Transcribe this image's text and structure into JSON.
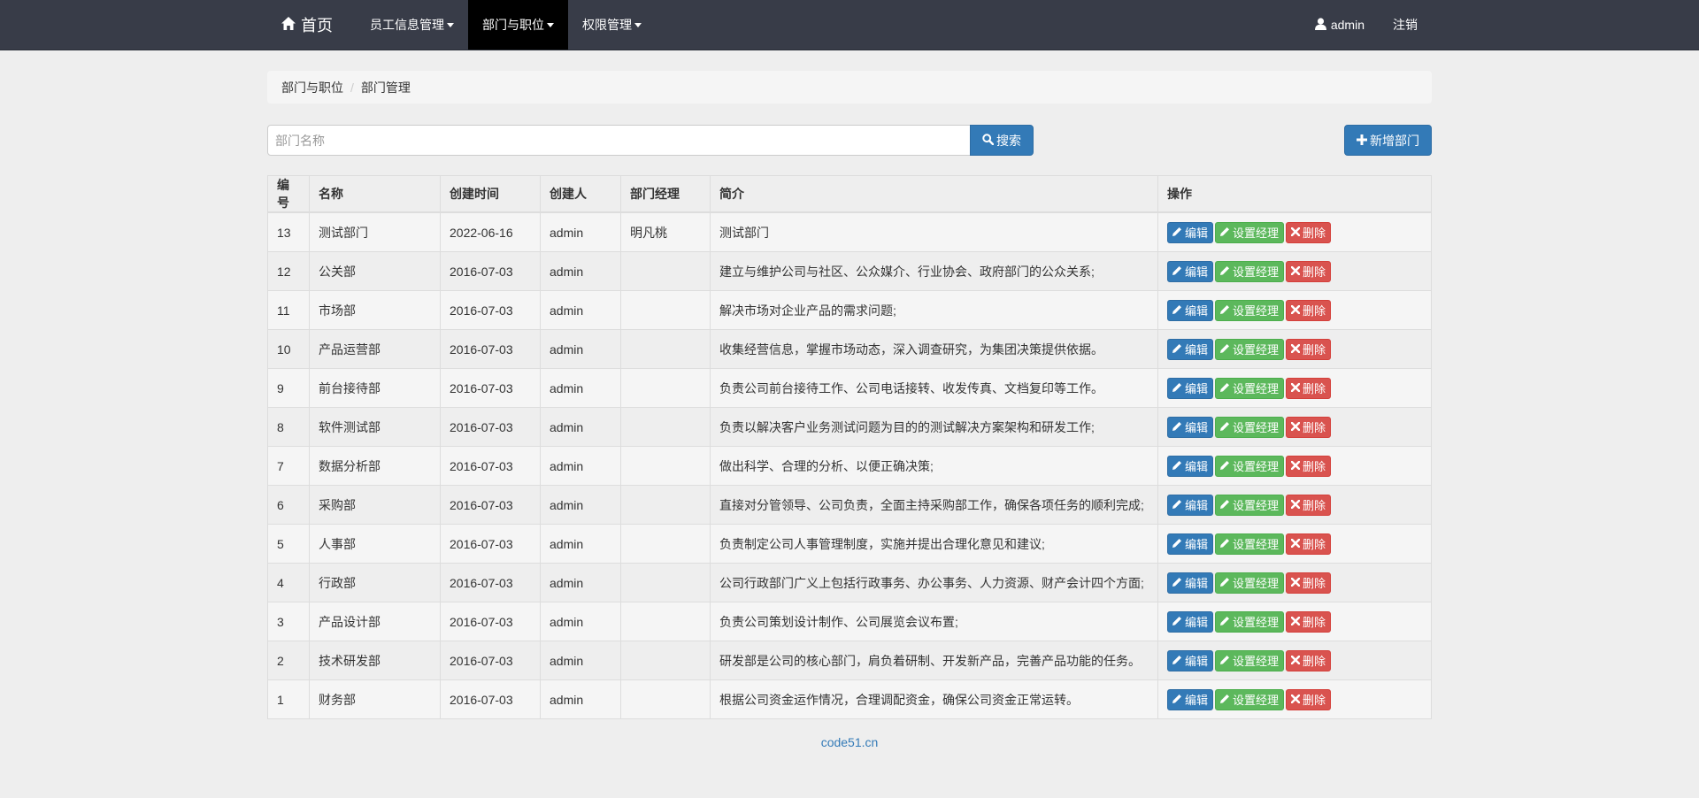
{
  "nav": {
    "brand": "首页",
    "menus": [
      {
        "label": "员工信息管理",
        "active": false
      },
      {
        "label": "部门与职位",
        "active": true
      },
      {
        "label": "权限管理",
        "active": false
      }
    ],
    "user": "admin",
    "logout": "注销"
  },
  "breadcrumb": {
    "parent": "部门与职位",
    "current": "部门管理"
  },
  "search": {
    "placeholder": "部门名称",
    "button": "搜索"
  },
  "add_button": "新增部门",
  "table": {
    "headers": [
      "编号",
      "名称",
      "创建时间",
      "创建人",
      "部门经理",
      "简介",
      "操作"
    ],
    "actions": {
      "edit": "编辑",
      "set_manager": "设置经理",
      "delete": "删除"
    },
    "rows": [
      {
        "id": "13",
        "name": "测试部门",
        "created": "2022-06-16",
        "creator": "admin",
        "manager": "明凡桃",
        "desc": "测试部门"
      },
      {
        "id": "12",
        "name": "公关部",
        "created": "2016-07-03",
        "creator": "admin",
        "manager": "",
        "desc": "建立与维护公司与社区、公众媒介、行业协会、政府部门的公众关系;"
      },
      {
        "id": "11",
        "name": "市场部",
        "created": "2016-07-03",
        "creator": "admin",
        "manager": "",
        "desc": "解决市场对企业产品的需求问题;"
      },
      {
        "id": "10",
        "name": "产品运营部",
        "created": "2016-07-03",
        "creator": "admin",
        "manager": "",
        "desc": "收集经营信息，掌握市场动态，深入调查研究，为集团决策提供依据。"
      },
      {
        "id": "9",
        "name": "前台接待部",
        "created": "2016-07-03",
        "creator": "admin",
        "manager": "",
        "desc": "负责公司前台接待工作、公司电话接转、收发传真、文档复印等工作。"
      },
      {
        "id": "8",
        "name": "软件测试部",
        "created": "2016-07-03",
        "creator": "admin",
        "manager": "",
        "desc": "负责以解决客户业务测试问题为目的的测试解决方案架构和研发工作;"
      },
      {
        "id": "7",
        "name": "数据分析部",
        "created": "2016-07-03",
        "creator": "admin",
        "manager": "",
        "desc": "做出科学、合理的分析、以便正确决策;"
      },
      {
        "id": "6",
        "name": "采购部",
        "created": "2016-07-03",
        "creator": "admin",
        "manager": "",
        "desc": "直接对分管领导、公司负责，全面主持采购部工作，确保各项任务的顺利完成;"
      },
      {
        "id": "5",
        "name": "人事部",
        "created": "2016-07-03",
        "creator": "admin",
        "manager": "",
        "desc": "负责制定公司人事管理制度，实施并提出合理化意见和建议;"
      },
      {
        "id": "4",
        "name": "行政部",
        "created": "2016-07-03",
        "creator": "admin",
        "manager": "",
        "desc": "公司行政部门广义上包括行政事务、办公事务、人力资源、财产会计四个方面;"
      },
      {
        "id": "3",
        "name": "产品设计部",
        "created": "2016-07-03",
        "creator": "admin",
        "manager": "",
        "desc": "负责公司策划设计制作、公司展览会议布置;"
      },
      {
        "id": "2",
        "name": "技术研发部",
        "created": "2016-07-03",
        "creator": "admin",
        "manager": "",
        "desc": "研发部是公司的核心部门，肩负着研制、开发新产品，完善产品功能的任务。"
      },
      {
        "id": "1",
        "name": "财务部",
        "created": "2016-07-03",
        "creator": "admin",
        "manager": "",
        "desc": "根据公司资金运作情况，合理调配资金，确保公司资金正常运转。"
      }
    ]
  },
  "footer": "code51.cn",
  "colors": {
    "navbar": "#383c48",
    "primary": "#337ab7",
    "success": "#5cb85c",
    "danger": "#d9534f"
  },
  "icons": [
    "home-icon",
    "user-icon",
    "search-icon",
    "plus-icon",
    "pencil-icon",
    "remove-icon"
  ]
}
